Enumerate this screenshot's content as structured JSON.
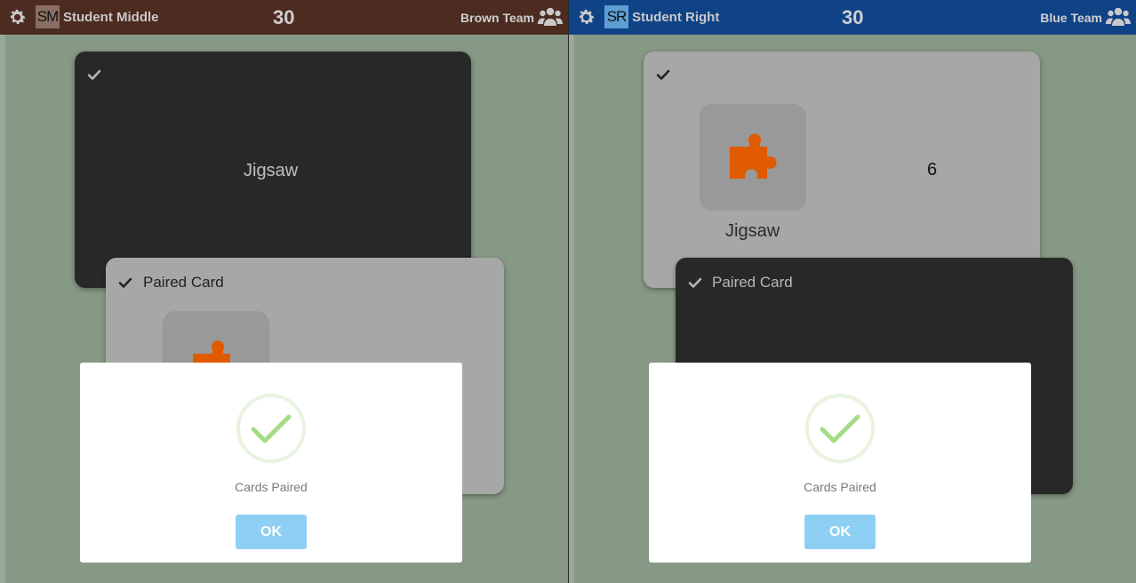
{
  "colors": {
    "brown_team": "#4c2b21",
    "blue_team": "#0f4386",
    "board_bg": "#869984",
    "dark_card": "#282828",
    "light_card": "#a7a7a7",
    "puzzle_orange": "#e05a00",
    "ok_button": "#8dd0f3",
    "success_green": "#a5dc86"
  },
  "left": {
    "header": {
      "settings_icon": "gear-icon",
      "avatar_initials": "SM",
      "student_name": "Student Middle",
      "score": "30",
      "team_name": "Brown Team",
      "team_icon": "users-icon"
    },
    "back_card": {
      "check_icon": "check-icon",
      "text": "Jigsaw"
    },
    "front_card": {
      "check_icon": "check-icon",
      "title": "Paired Card",
      "tile_icon": "puzzle-piece-icon"
    },
    "dialog": {
      "icon": "success-check-icon",
      "message": "Cards Paired",
      "ok_label": "OK"
    }
  },
  "right": {
    "header": {
      "settings_icon": "gear-icon",
      "avatar_initials": "SR",
      "student_name": "Student Right",
      "score": "30",
      "team_name": "Blue Team",
      "team_icon": "users-icon"
    },
    "back_card": {
      "check_icon": "check-icon",
      "tile_icon": "puzzle-piece-icon",
      "tile_label": "Jigsaw",
      "count": "6"
    },
    "front_card": {
      "check_icon": "check-icon",
      "title": "Paired Card"
    },
    "dialog": {
      "icon": "success-check-icon",
      "message": "Cards Paired",
      "ok_label": "OK"
    }
  }
}
